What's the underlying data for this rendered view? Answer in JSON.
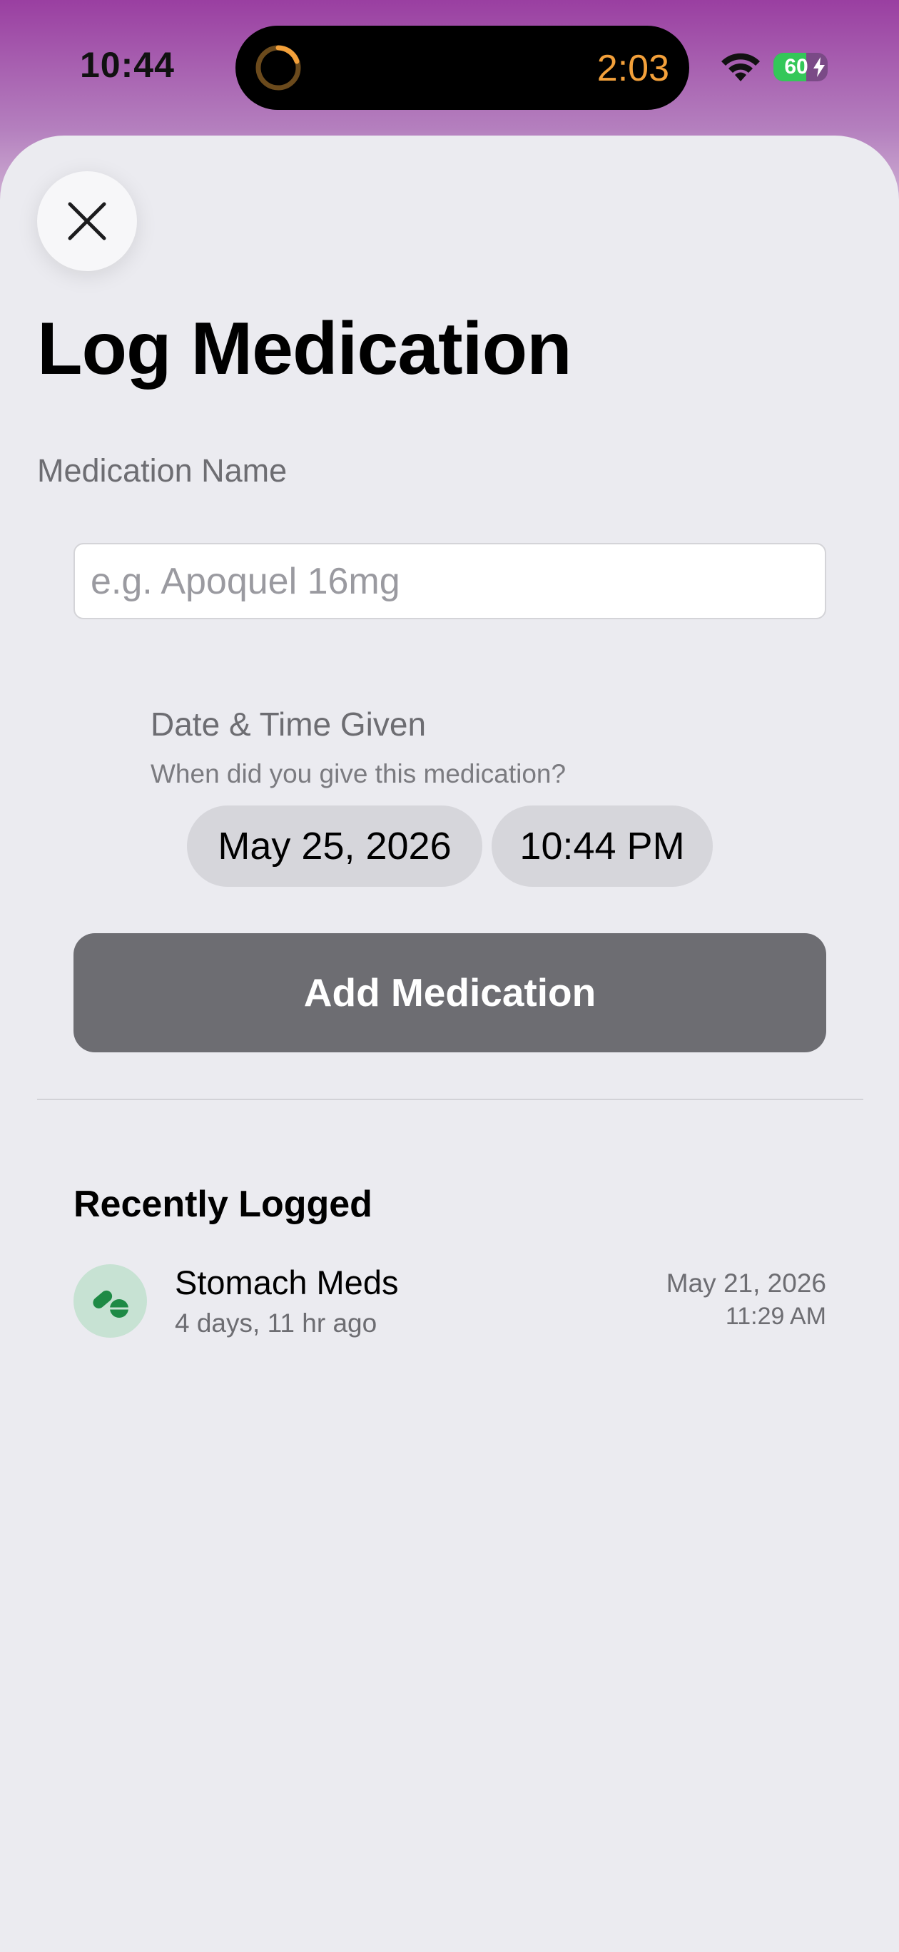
{
  "status_bar": {
    "time": "10:44",
    "timer": "2:03",
    "battery_level": "60",
    "battery_fraction": 0.6
  },
  "colors": {
    "accent_orange": "#f3a03a",
    "battery_green": "#34c759",
    "button_gray": "#6d6d72",
    "pill_green": "#1e8a45"
  },
  "sheet": {
    "title": "Log Medication",
    "medication_name_label": "Medication Name",
    "medication_input": {
      "value": "",
      "placeholder": "e.g. Apoquel 16mg"
    },
    "datetime_label": "Date & Time Given",
    "datetime_subtitle": "When did you give this medication?",
    "date_value": "May 25, 2026",
    "time_value": "10:44 PM",
    "add_button_label": "Add Medication"
  },
  "recent": {
    "title": "Recently Logged",
    "items": [
      {
        "icon": "pills-icon",
        "name": "Stomach Meds",
        "ago": "4 days, 11 hr ago",
        "date": "May 21, 2026",
        "time": "11:29 AM"
      }
    ]
  }
}
